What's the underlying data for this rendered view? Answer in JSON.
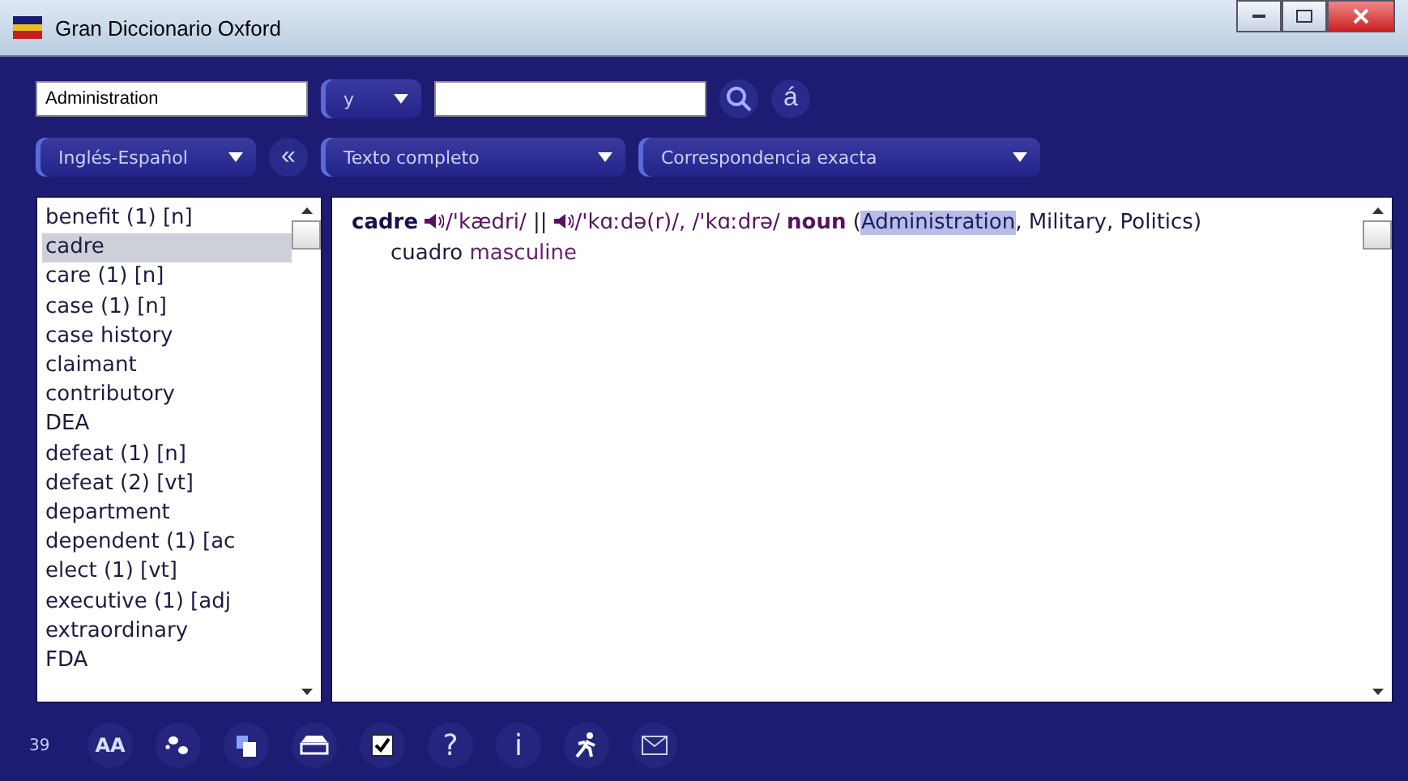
{
  "window": {
    "title": "Gran Diccionario Oxford"
  },
  "search": {
    "value": "Administration",
    "operator": "y",
    "accent_button": "á"
  },
  "options": {
    "language": "Inglés-Español",
    "collapse": "«",
    "scope": "Texto completo",
    "match": "Correspondencia exacta"
  },
  "word_list": [
    {
      "text": "benefit (1) [n]",
      "selected": false
    },
    {
      "text": "cadre",
      "selected": true
    },
    {
      "text": "care (1) [n]",
      "selected": false
    },
    {
      "text": "case (1) [n]",
      "selected": false
    },
    {
      "text": "case history",
      "selected": false
    },
    {
      "text": "claimant",
      "selected": false
    },
    {
      "text": "contributory",
      "selected": false
    },
    {
      "text": "DEA",
      "selected": false
    },
    {
      "text": "defeat (1) [n]",
      "selected": false
    },
    {
      "text": "defeat (2) [vt]",
      "selected": false
    },
    {
      "text": "department",
      "selected": false
    },
    {
      "text": "dependent (1) [ac",
      "selected": false
    },
    {
      "text": "elect (1) [vt]",
      "selected": false
    },
    {
      "text": "executive (1) [adj",
      "selected": false
    },
    {
      "text": "extraordinary",
      "selected": false
    },
    {
      "text": "FDA",
      "selected": false
    }
  ],
  "entry": [
    {
      "kind": "headword",
      "text": "cadre"
    },
    {
      "kind": "speaker"
    },
    {
      "kind": "pron",
      "text": "/'kædri/"
    },
    {
      "kind": "plain",
      "text": "||"
    },
    {
      "kind": "speaker"
    },
    {
      "kind": "pron",
      "text": "/'kɑːdə(r)/,"
    },
    {
      "kind": "pron",
      "text": "/'kɑːdrə/"
    },
    {
      "kind": "pos",
      "text": "noun"
    },
    {
      "kind": "plain",
      "text": "("
    },
    {
      "kind": "highlight",
      "text": "Administration"
    },
    {
      "kind": "plain",
      "text": ", Military, Politics) cuadro"
    },
    {
      "kind": "gender",
      "text": "masculine"
    }
  ],
  "toolbar": {
    "counter": "39",
    "buttons": [
      "AA",
      "?",
      "i"
    ]
  }
}
